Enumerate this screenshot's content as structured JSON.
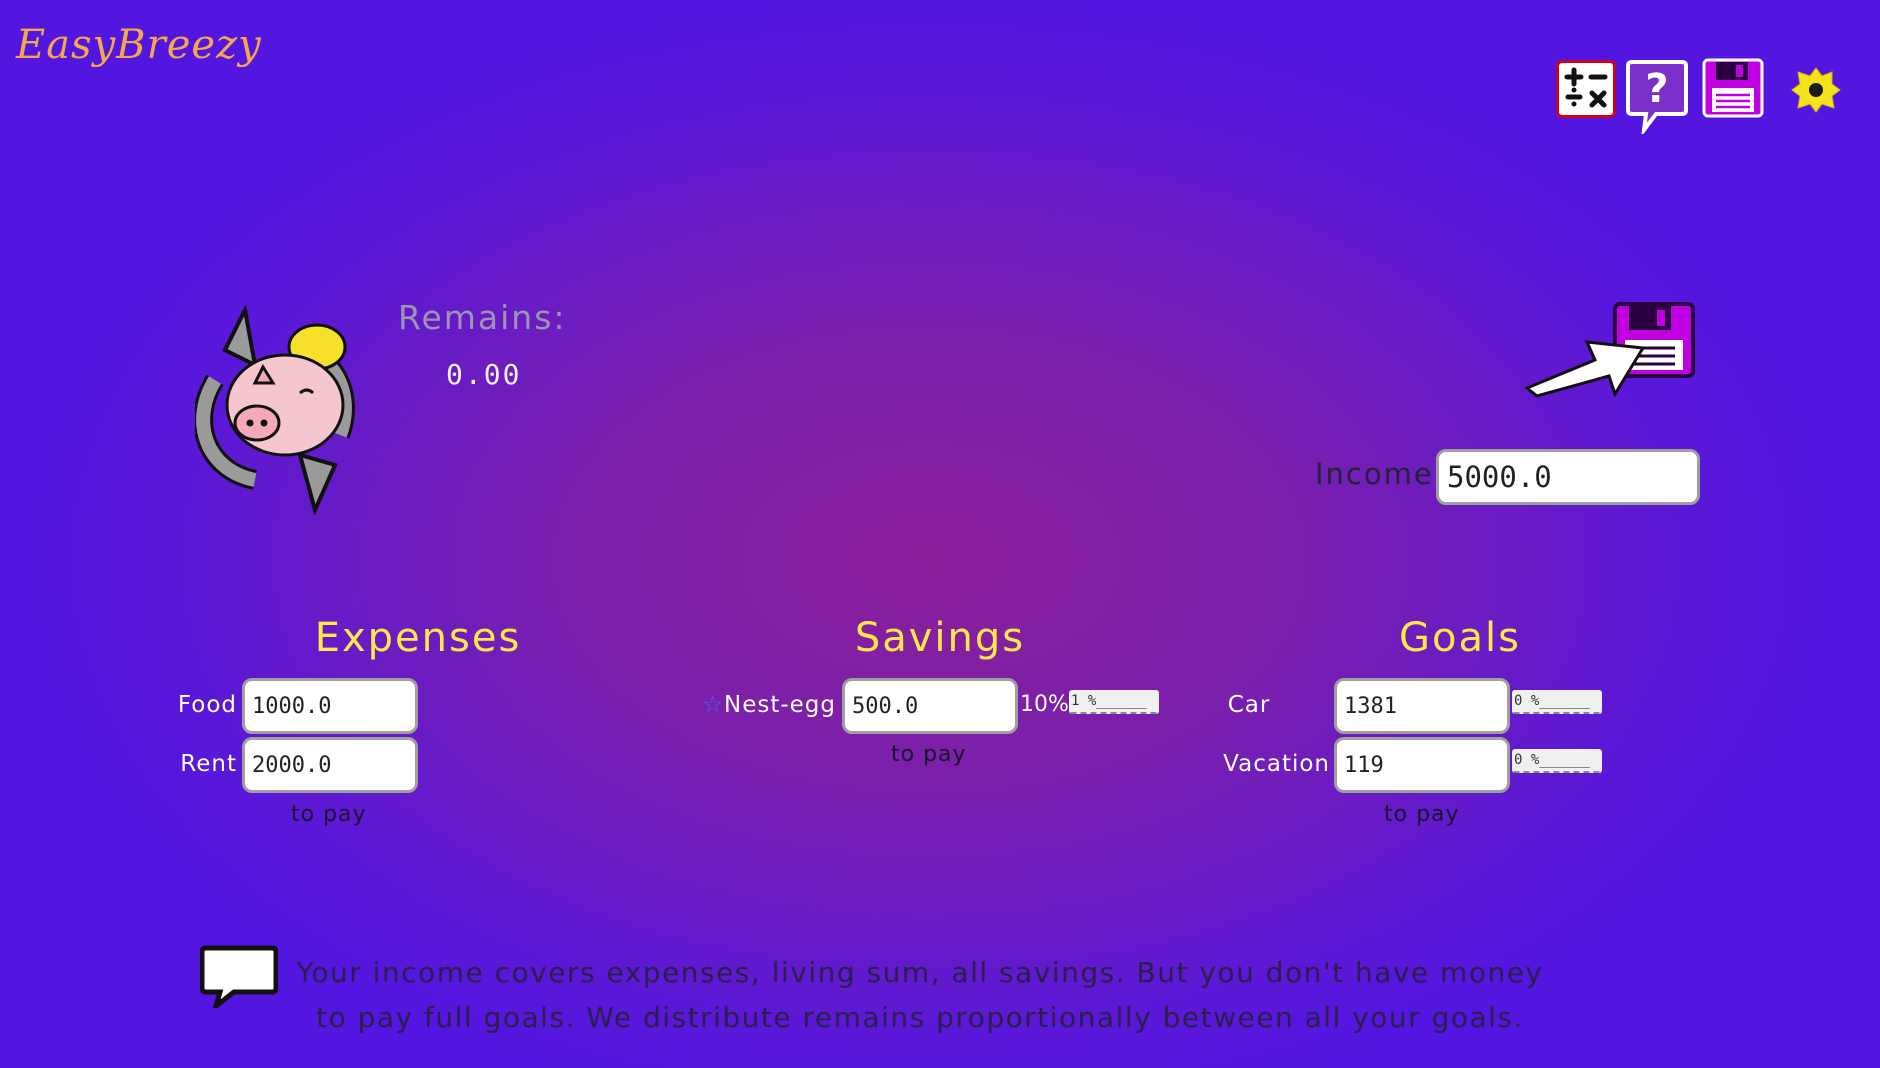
{
  "app": {
    "logo": "EasyBreezy"
  },
  "toolbar": {
    "icons": [
      "calculator-icon",
      "help-icon",
      "save-icon",
      "settings-icon"
    ]
  },
  "summary": {
    "remains_label": "Remains:",
    "remains_value": "0.00"
  },
  "income": {
    "label": "Income",
    "value": "5000.0"
  },
  "expenses": {
    "title": "Expenses",
    "items": [
      {
        "label": "Food",
        "value": "1000.0"
      },
      {
        "label": "Rent",
        "value": "2000.0"
      }
    ],
    "footer": "to pay"
  },
  "savings": {
    "title": "Savings",
    "items": [
      {
        "star": "☆",
        "label": "Nest-egg",
        "value": "500.0",
        "percent_text": "10%",
        "percent_field": "1 %______"
      }
    ],
    "footer": "to pay"
  },
  "goals": {
    "title": "Goals",
    "items": [
      {
        "label": "Car",
        "value": "1381",
        "percent_field": "0 %______"
      },
      {
        "label": "Vacation",
        "value": "119",
        "percent_field": "0 %______"
      }
    ],
    "footer": "to pay"
  },
  "message": "Your income covers expenses, living sum, all savings. But you don't have money to pay full goals. We distribute remains proportionally between all your goals.",
  "colors": {
    "accent_yellow": "#ffe84a",
    "logo_orange": "#f5a84a",
    "calc_red": "#d0021b",
    "save_magenta": "#c000e0"
  }
}
